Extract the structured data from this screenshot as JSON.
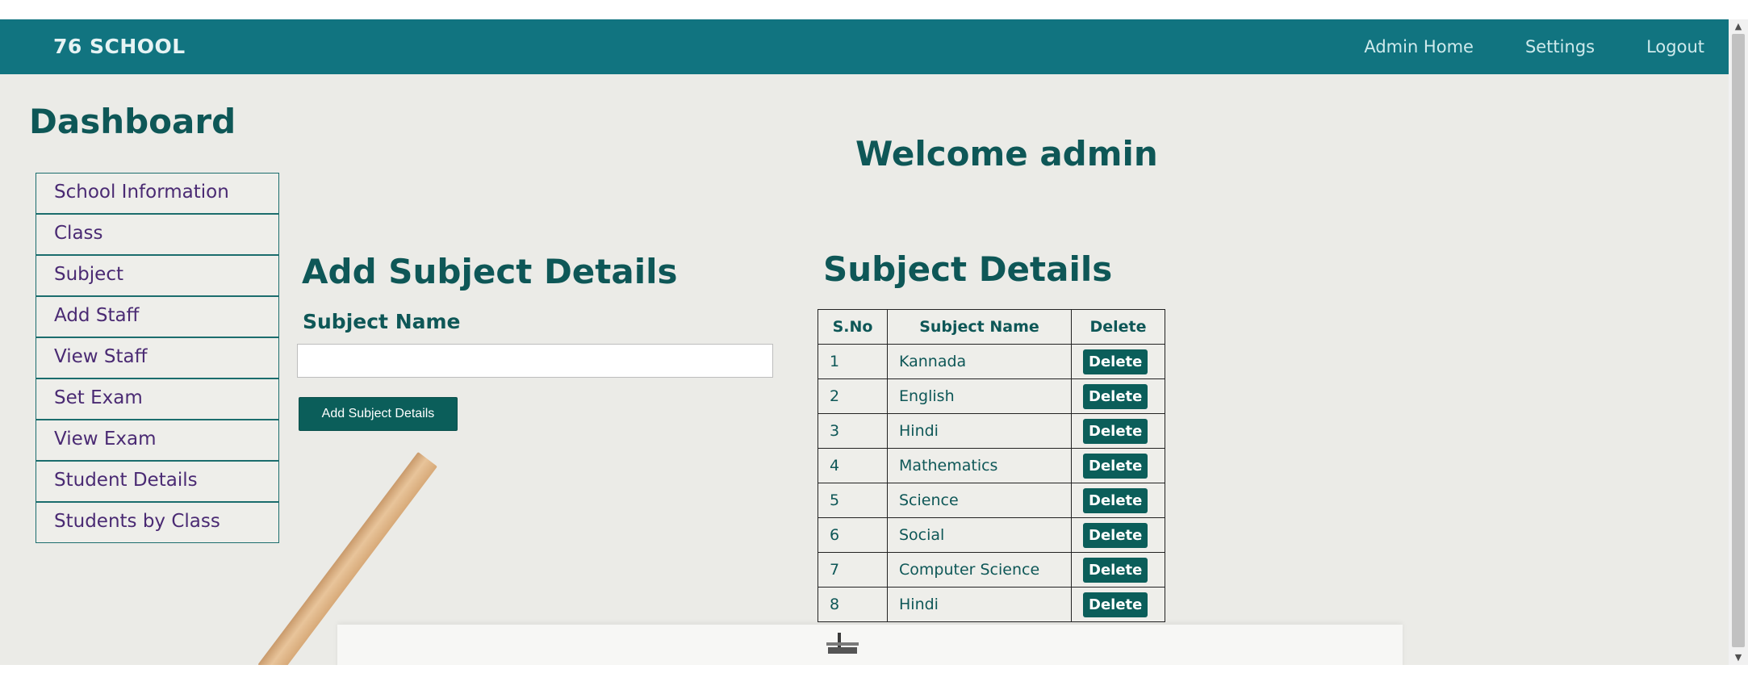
{
  "navbar": {
    "brand": "76 SCHOOL",
    "links": [
      "Admin Home",
      "Settings",
      "Logout"
    ]
  },
  "sidebar": {
    "title": "Dashboard",
    "items": [
      "School Information",
      "Class",
      "Subject",
      "Add Staff",
      "View Staff",
      "Set Exam",
      "View Exam",
      "Student Details",
      "Students by Class"
    ]
  },
  "welcome": "Welcome admin",
  "form": {
    "title": "Add Subject Details",
    "label": "Subject Name",
    "input_value": "",
    "button": "Add Subject Details"
  },
  "subjects_table": {
    "title": "Subject Details",
    "headers": [
      "S.No",
      "Subject Name",
      "Delete"
    ],
    "rows": [
      {
        "sno": "1",
        "name": "Kannada",
        "action": "Delete"
      },
      {
        "sno": "2",
        "name": "English",
        "action": "Delete"
      },
      {
        "sno": "3",
        "name": "Hindi",
        "action": "Delete"
      },
      {
        "sno": "4",
        "name": "Mathematics",
        "action": "Delete"
      },
      {
        "sno": "5",
        "name": "Science",
        "action": "Delete"
      },
      {
        "sno": "6",
        "name": "Social",
        "action": "Delete"
      },
      {
        "sno": "7",
        "name": "Computer Science",
        "action": "Delete"
      },
      {
        "sno": "8",
        "name": "Hindi",
        "action": "Delete"
      }
    ]
  },
  "colors": {
    "navbar": "#117480",
    "heading": "#0e5757",
    "button": "#0b5e5a",
    "menu_text": "#4a2a73",
    "background": "#ebebe7"
  },
  "icons": {
    "scroll_up": "triangle-up-icon",
    "scroll_down": "triangle-down-icon"
  }
}
